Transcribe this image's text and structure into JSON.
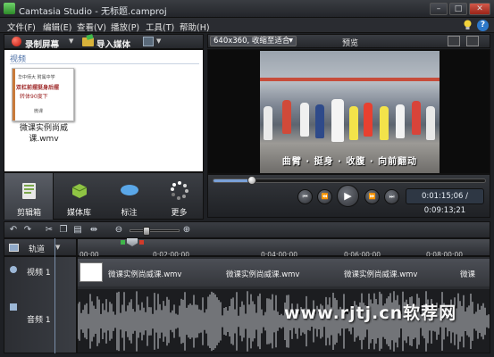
{
  "window": {
    "title": "Camtasia Studio - 无标题.camproj",
    "minimize": "–",
    "maximize": "□",
    "close": "✕"
  },
  "menu": [
    "文件(F)",
    "编辑(E)",
    "查看(V)",
    "播放(P)",
    "工具(T)",
    "帮助(H)"
  ],
  "help_glyph": "?",
  "left_toolbar": {
    "record": "录制屏幕",
    "import": "导入媒体"
  },
  "clip_bin": {
    "section": "视频",
    "clip": {
      "name": "微课实例尚威课.wmv",
      "thumb_line1": "华中师大 附属中学",
      "thumb_line2": "双杠前摆挺身后摆",
      "thumb_line3": "转体90度下",
      "thumb_line4": "微课"
    }
  },
  "tabs": [
    {
      "label": "剪辑箱",
      "icon": "clip-bin-icon"
    },
    {
      "label": "媒体库",
      "icon": "library-icon"
    },
    {
      "label": "标注",
      "icon": "callout-icon"
    },
    {
      "label": "更多",
      "icon": "more-icon"
    }
  ],
  "preview": {
    "zoom": "640x360, 收缩至适合",
    "title": "预览",
    "subtitle": "曲臂 · 挺身 · 收腹 · 向前翻动"
  },
  "transport": {
    "buttons": [
      "⏮",
      "⏪",
      "▶",
      "⏩",
      "⏭"
    ],
    "timecode": "0:01:15;06 / 0:09:13;21",
    "progress": 0.14
  },
  "timeline": {
    "toolbar_icons": [
      "undo-icon",
      "redo-icon",
      "cut-icon",
      "copy-icon",
      "paste-icon",
      "split-icon",
      "zoom-out-icon",
      "zoom-in-icon"
    ],
    "tracks_label": "轨道",
    "ruler": [
      "00:00",
      "0:02:00;00",
      "0:04:00;00",
      "0:06:00;00",
      "0:08:00;00"
    ],
    "tracks": [
      {
        "name": "视频 1",
        "clips": [
          "微课实例尚威课.wmv",
          "微课实例尚威课.wmv",
          "微课实例尚威课.wmv",
          "微课"
        ]
      },
      {
        "name": "音频 1"
      }
    ]
  },
  "watermark": "www.rjtj.cn软荐网"
}
